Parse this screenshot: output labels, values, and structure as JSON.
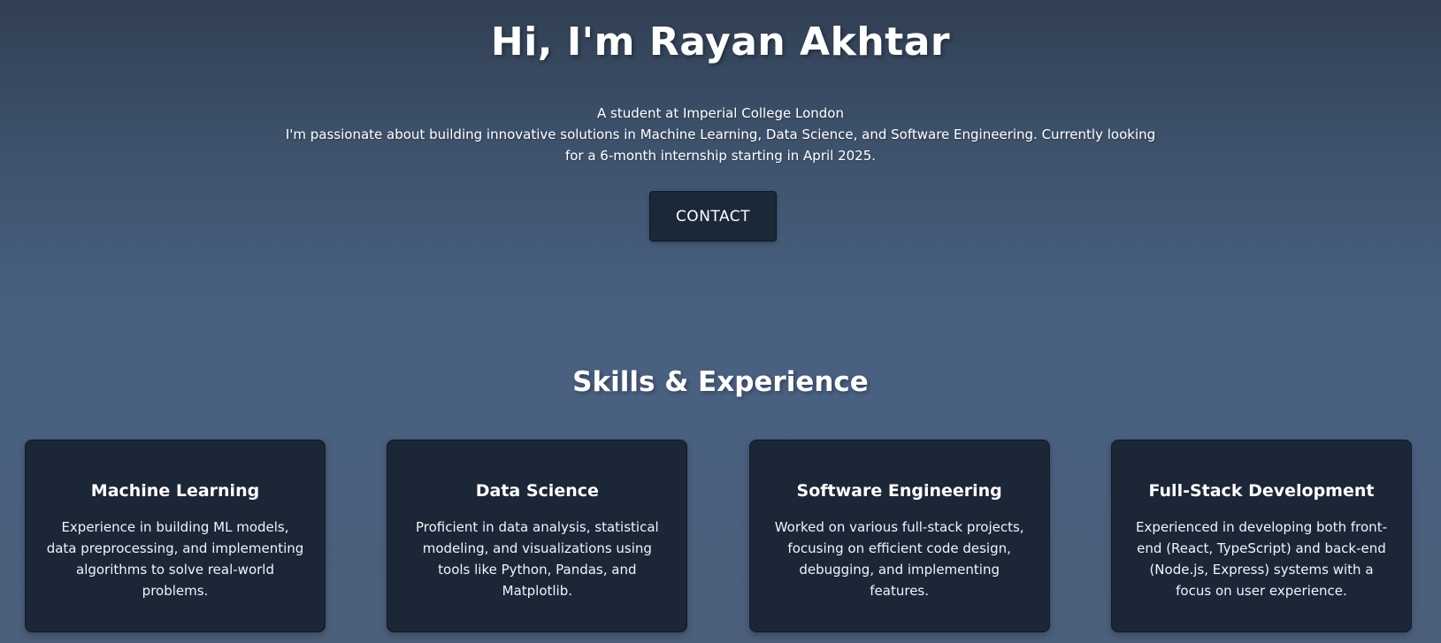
{
  "hero": {
    "title": "Hi, I'm Rayan Akhtar",
    "line1": "A student at Imperial College London",
    "line2": "I'm passionate about building innovative solutions in Machine Learning, Data Science, and Software Engineering. Currently looking for a 6-month internship starting in April 2025.",
    "contact_label": "CONTACT"
  },
  "skills": {
    "title": "Skills & Experience",
    "cards": [
      {
        "title": "Machine Learning",
        "description": "Experience in building ML models, data preprocessing, and implementing algorithms to solve real-world problems."
      },
      {
        "title": "Data Science",
        "description": "Proficient in data analysis, statistical modeling, and visualizations using tools like Python, Pandas, and Matplotlib."
      },
      {
        "title": "Software Engineering",
        "description": "Worked on various full-stack projects, focusing on efficient code design, debugging, and implementing features."
      },
      {
        "title": "Full-Stack Development",
        "description": "Experienced in developing both front-end (React, TypeScript) and back-end (Node.js, Express) systems with a focus on user experience."
      }
    ]
  },
  "colors": {
    "background_top": "#313f53",
    "background_mid": "#475f7e",
    "card_background": "#1b2637",
    "button_background": "#1b2838",
    "text": "#ffffff"
  }
}
